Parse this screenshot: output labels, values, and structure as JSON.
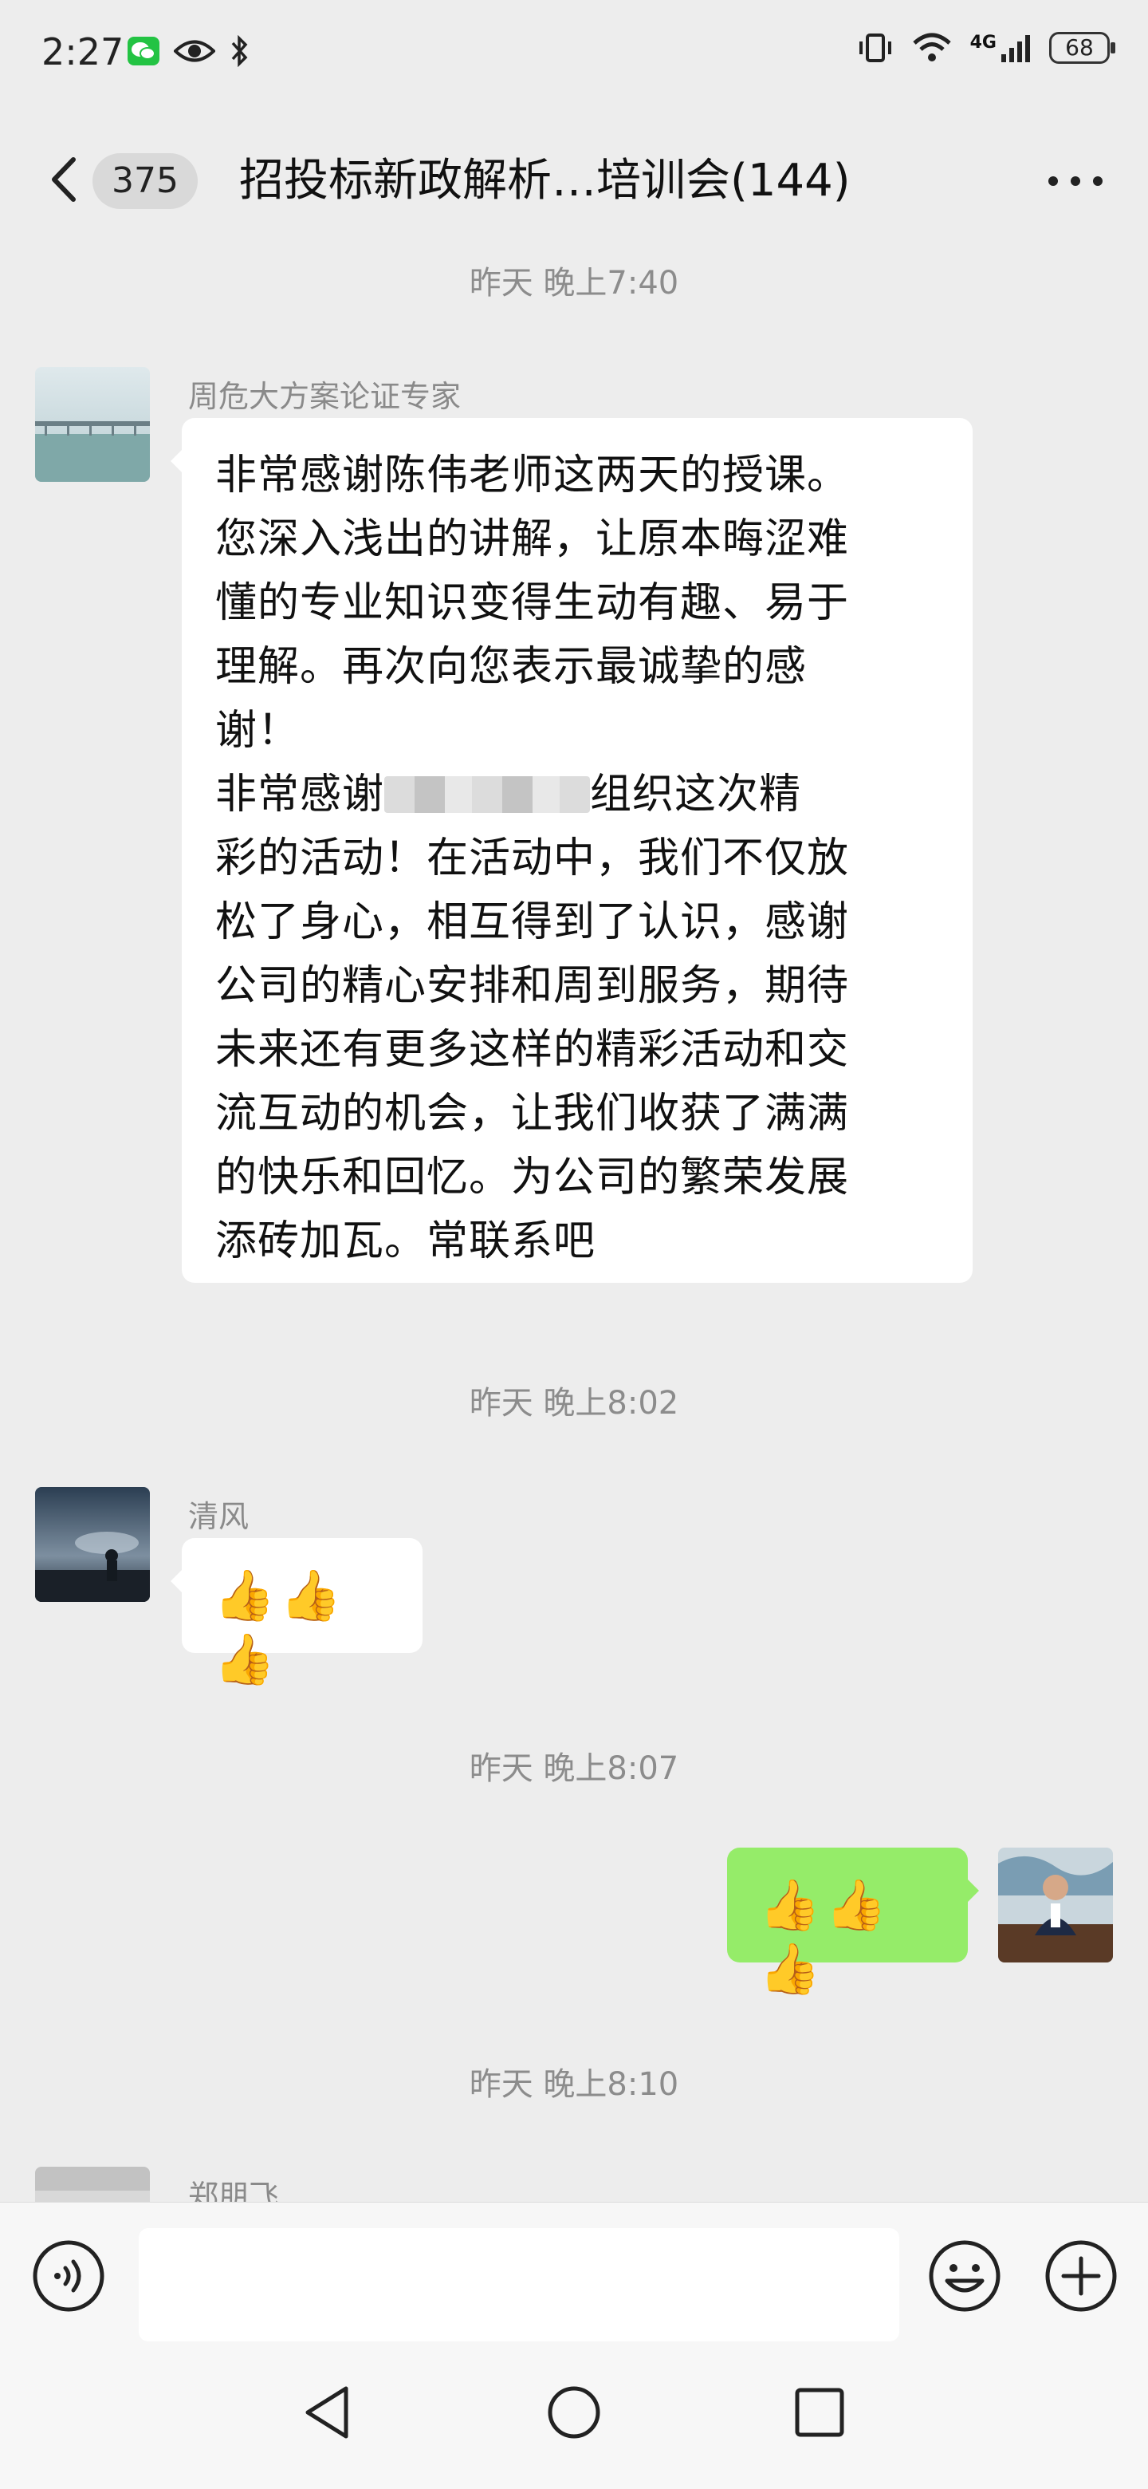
{
  "status_bar": {
    "time": "2:27",
    "network": "4G",
    "battery": "68"
  },
  "nav": {
    "unread_count": "375",
    "title": "招投标新政解析…培训会(144)"
  },
  "messages": [
    {
      "time": "昨天 晚上7:40",
      "sender": "周危大方案论证专家",
      "lines": [
        "非常感谢陈伟老师这两天的授课。",
        "您深入浅出的讲解，让原本晦涩难",
        "懂的专业知识变得生动有趣、易于",
        "理解。再次向您表示最诚挚的感",
        "谢！",
        "组织这次精",
        "彩的活动！在活动中，我们不仅放",
        "松了身心，相互得到了认识，感谢",
        "公司的精心安排和周到服务，期待",
        "未来还有更多这样的精彩活动和交",
        "流互动的机会，让我们收获了满满",
        "的快乐和回忆。为公司的繁荣发展",
        "添砖加瓦。常联系吧"
      ],
      "line6_prefix": "非常感谢"
    },
    {
      "time": "昨天 晚上8:02",
      "sender": "清风",
      "text": "👍👍👍"
    },
    {
      "time": "昨天 晚上8:07",
      "sender": "",
      "text": "👍👍👍"
    },
    {
      "time": "昨天 晚上8:10",
      "sender": "郑朋飞"
    }
  ],
  "icons": {
    "back": "chevron-left-icon",
    "more": "more-horizontal-icon",
    "voice": "voice-icon",
    "emoji": "emoji-icon",
    "plus": "plus-icon"
  },
  "colors": {
    "outgoing_bubble": "#95ec69",
    "incoming_bubble": "#ffffff",
    "background": "#ededed"
  }
}
